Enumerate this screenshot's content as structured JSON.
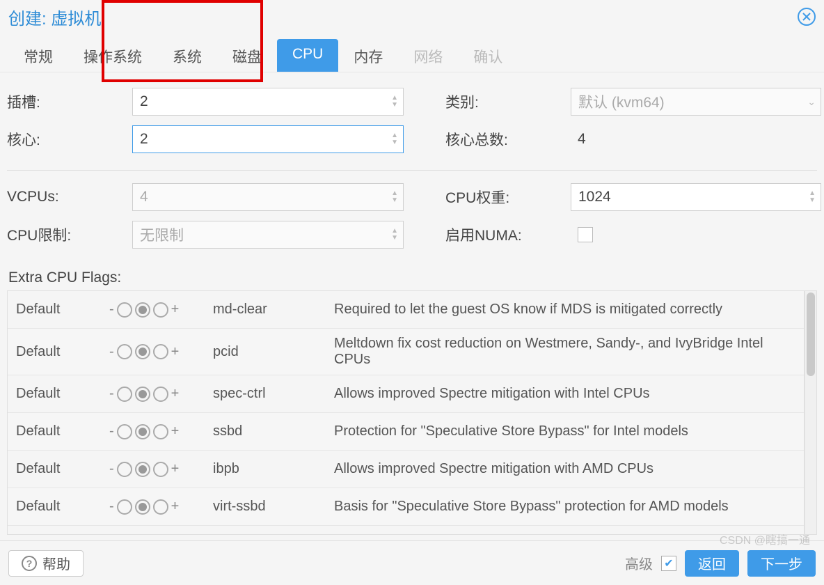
{
  "title_prefix": "创建:",
  "title_subject": "虚拟机",
  "tabs": {
    "general": "常规",
    "os": "操作系统",
    "system": "系统",
    "disk": "磁盘",
    "cpu": "CPU",
    "memory": "内存",
    "network": "网络",
    "confirm": "确认"
  },
  "form": {
    "sockets_label": "插槽:",
    "sockets_value": "2",
    "cores_label": "核心:",
    "cores_value": "2",
    "type_label": "类别:",
    "type_value": "默认 (kvm64)",
    "totalcores_label": "核心总数:",
    "totalcores_value": "4",
    "vcpus_label": "VCPUs:",
    "vcpus_value": "4",
    "cpuweight_label": "CPU权重:",
    "cpuweight_value": "1024",
    "cpulimit_label": "CPU限制:",
    "cpulimit_value": "无限制",
    "numa_label": "启用NUMA:"
  },
  "flags_title": "Extra CPU Flags:",
  "flags": [
    {
      "state": "Default",
      "name": "md-clear",
      "desc": "Required to let the guest OS know if MDS is mitigated correctly"
    },
    {
      "state": "Default",
      "name": "pcid",
      "desc": "Meltdown fix cost reduction on Westmere, Sandy-, and IvyBridge Intel CPUs"
    },
    {
      "state": "Default",
      "name": "spec-ctrl",
      "desc": "Allows improved Spectre mitigation with Intel CPUs"
    },
    {
      "state": "Default",
      "name": "ssbd",
      "desc": "Protection for \"Speculative Store Bypass\" for Intel models"
    },
    {
      "state": "Default",
      "name": "ibpb",
      "desc": "Allows improved Spectre mitigation with AMD CPUs"
    },
    {
      "state": "Default",
      "name": "virt-ssbd",
      "desc": "Basis for \"Speculative Store Bypass\" protection for AMD models"
    }
  ],
  "footer": {
    "help": "帮助",
    "advanced": "高级",
    "back": "返回",
    "next": "下一步"
  },
  "watermark": "CSDN @瞎搞一通"
}
